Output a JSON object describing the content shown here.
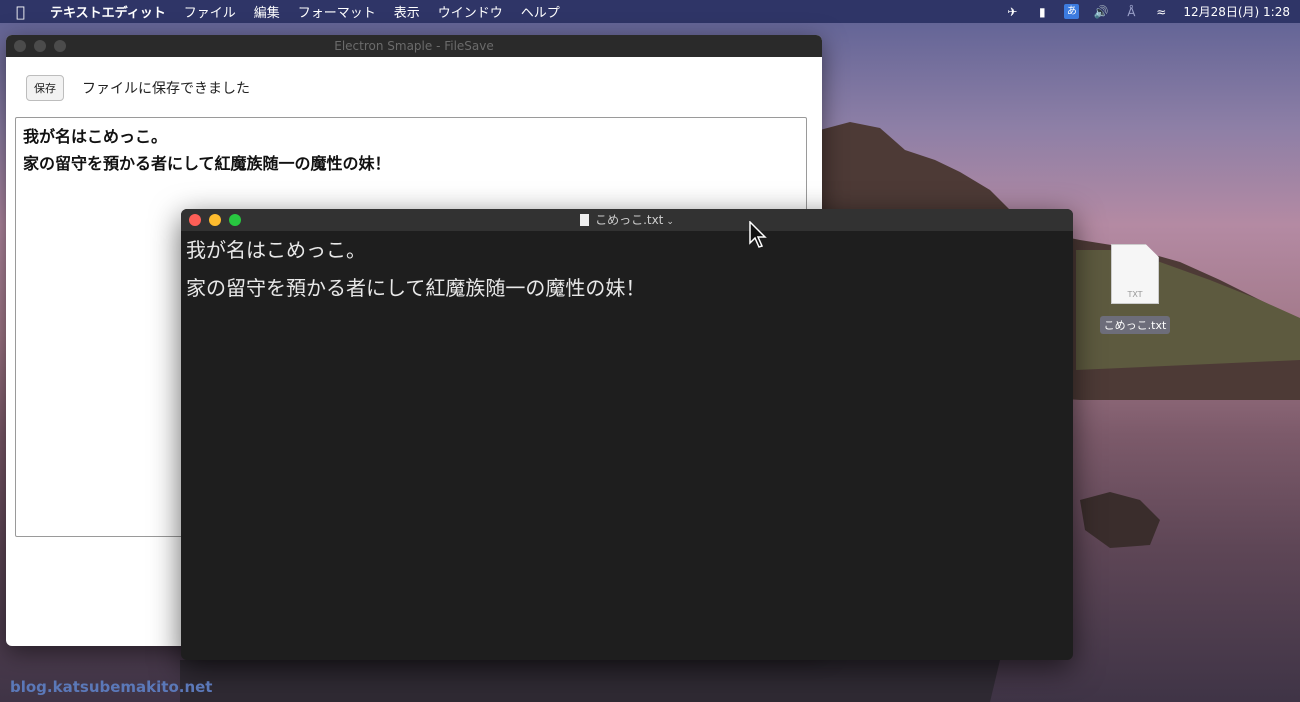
{
  "menubar": {
    "items": [
      "テキストエディット",
      "ファイル",
      "編集",
      "フォーマット",
      "表示",
      "ウインドウ",
      "ヘルプ"
    ],
    "clock": "12月28日(月) 1:28",
    "ime": "あ"
  },
  "electron": {
    "title": "Electron Smaple - FileSave",
    "save_label": "保存",
    "status_message": "ファイルに保存できました",
    "text_lines": [
      "我が名はこめっこ。",
      "家の留守を預かる者にして紅魔族随一の魔性の妹！"
    ]
  },
  "textedit": {
    "title": "こめっこ.txt",
    "lines": [
      "我が名はこめっこ。",
      "家の留守を預かる者にして紅魔族随一の魔性の妹！"
    ]
  },
  "desktop": {
    "file_name": "こめっこ.txt",
    "file_badge": "TXT",
    "watermark": "blog.katsubemakito.net"
  },
  "icons": [
    "apple-icon",
    "airplay-icon",
    "battery-icon",
    "ime-icon",
    "volume-icon",
    "bluetooth-icon",
    "wifi-icon",
    "document-icon",
    "mouse-cursor-icon"
  ]
}
